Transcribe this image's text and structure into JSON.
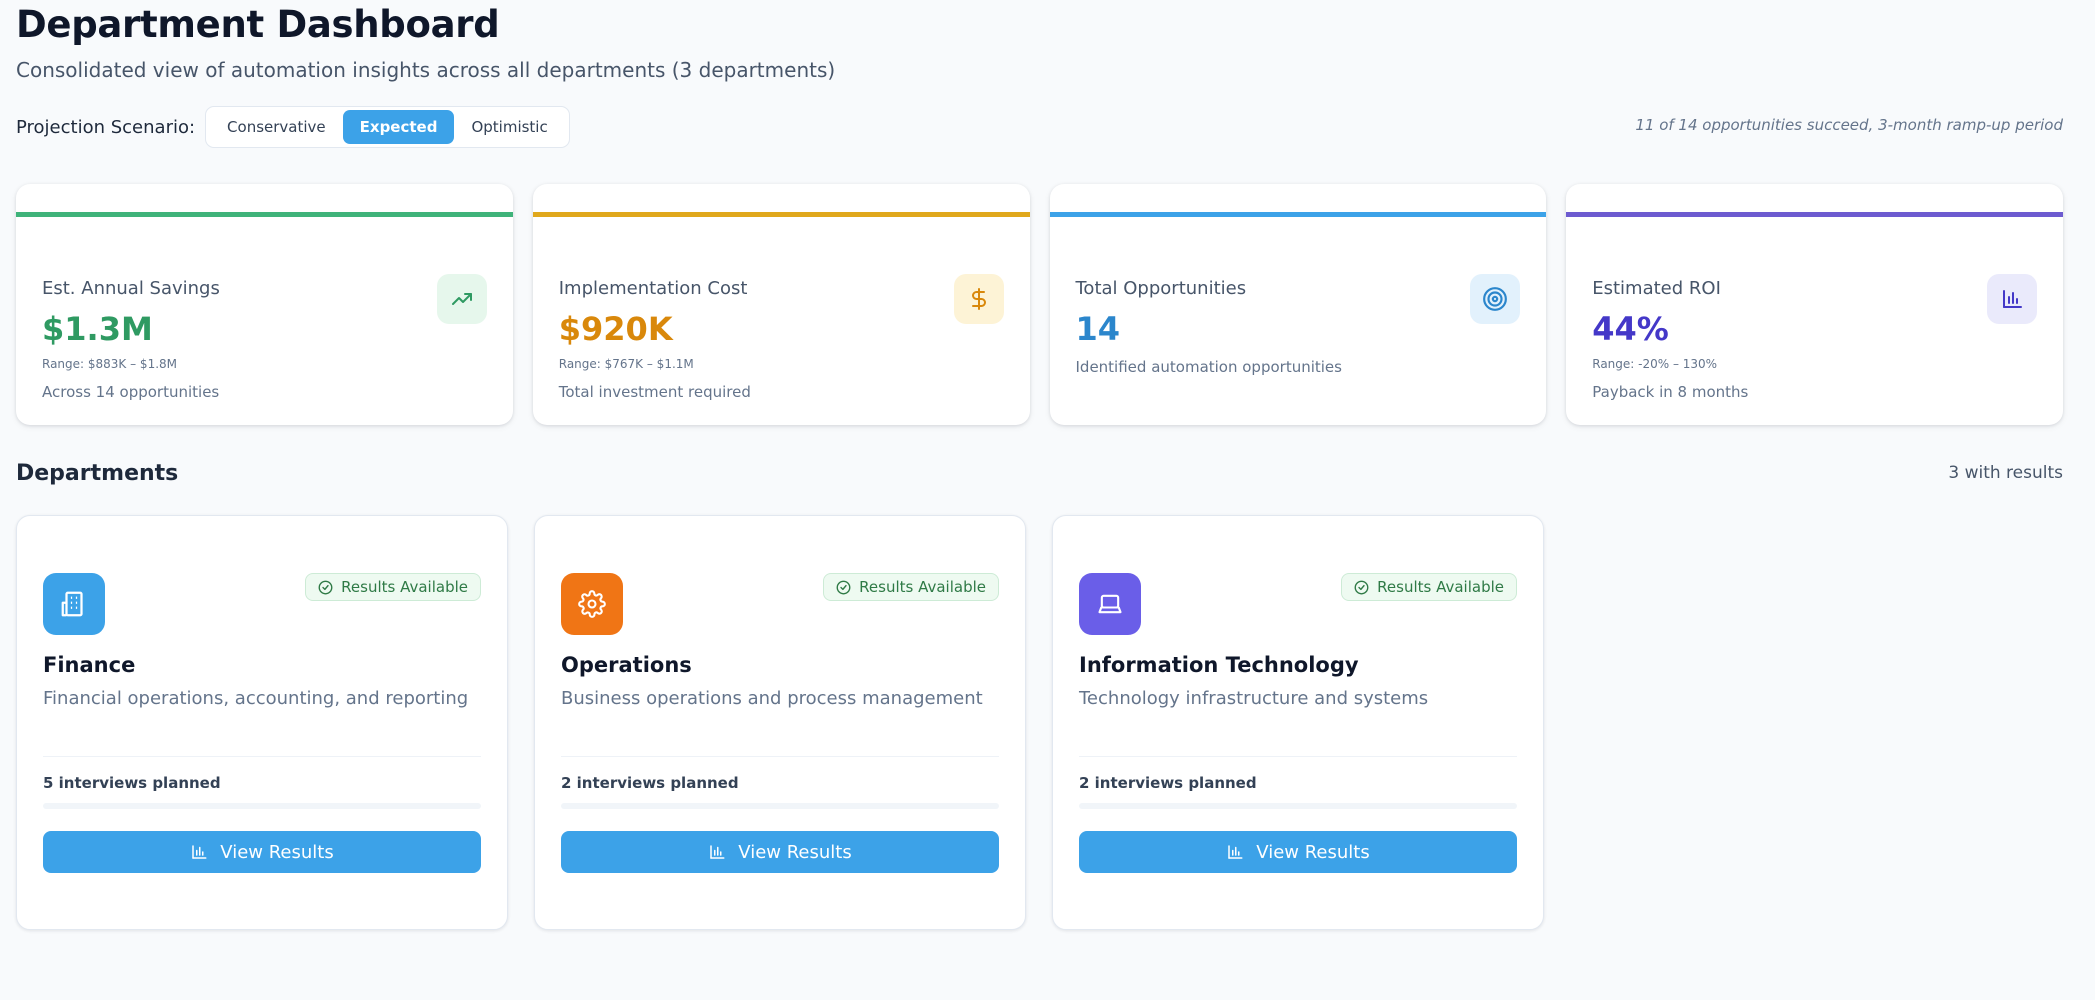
{
  "header": {
    "title": "Department Dashboard",
    "subtitle": "Consolidated view of automation insights across all departments (3 departments)"
  },
  "scenario": {
    "label": "Projection Scenario:",
    "options": [
      "Conservative",
      "Expected",
      "Optimistic"
    ],
    "selected": "Expected",
    "note": "11 of 14 opportunities succeed, 3-month ramp-up period"
  },
  "stats": [
    {
      "label": "Est. Annual Savings",
      "value": "$1.3M",
      "range": "Range: $883K – $1.8M",
      "note": "Across 14 opportunities",
      "icon": "trending-up-icon",
      "accent": "#3fb37a",
      "value_color": "#2f9a62",
      "icon_bg": "#e6f7ec"
    },
    {
      "label": "Implementation Cost",
      "value": "$920K",
      "range": "Range: $767K – $1.1M",
      "note": "Total investment required",
      "icon": "dollar-icon",
      "accent": "#e0a81c",
      "value_color": "#d9880b",
      "icon_bg": "#fdf3d6"
    },
    {
      "label": "Total Opportunities",
      "value": "14",
      "note": "Identified automation opportunities",
      "icon": "target-icon",
      "accent": "#3ca2e8",
      "value_color": "#2b86cc",
      "icon_bg": "#e2f1fc"
    },
    {
      "label": "Estimated ROI",
      "value": "44%",
      "range": "Range: -20% – 130%",
      "note": "Payback in 8 months",
      "icon": "bar-chart-icon",
      "accent": "#6d5bd0",
      "value_color": "#4438c8",
      "icon_bg": "#eaeafb"
    }
  ],
  "departments_section": {
    "title": "Departments",
    "count_label": "3 with results"
  },
  "departments": [
    {
      "name": "Finance",
      "description": "Financial operations, accounting, and reporting",
      "badge": "Results Available",
      "interviews": "5 interviews planned",
      "progress": 0,
      "button": "View Results",
      "icon": "building-icon",
      "icon_bg": "#3ca2e8"
    },
    {
      "name": "Operations",
      "description": "Business operations and process management",
      "badge": "Results Available",
      "interviews": "2 interviews planned",
      "progress": 0,
      "button": "View Results",
      "icon": "gear-icon",
      "icon_bg": "#f07515"
    },
    {
      "name": "Information Technology",
      "description": "Technology infrastructure and systems",
      "badge": "Results Available",
      "interviews": "2 interviews planned",
      "progress": 0,
      "button": "View Results",
      "icon": "laptop-icon",
      "icon_bg": "#6a5ee8"
    }
  ]
}
